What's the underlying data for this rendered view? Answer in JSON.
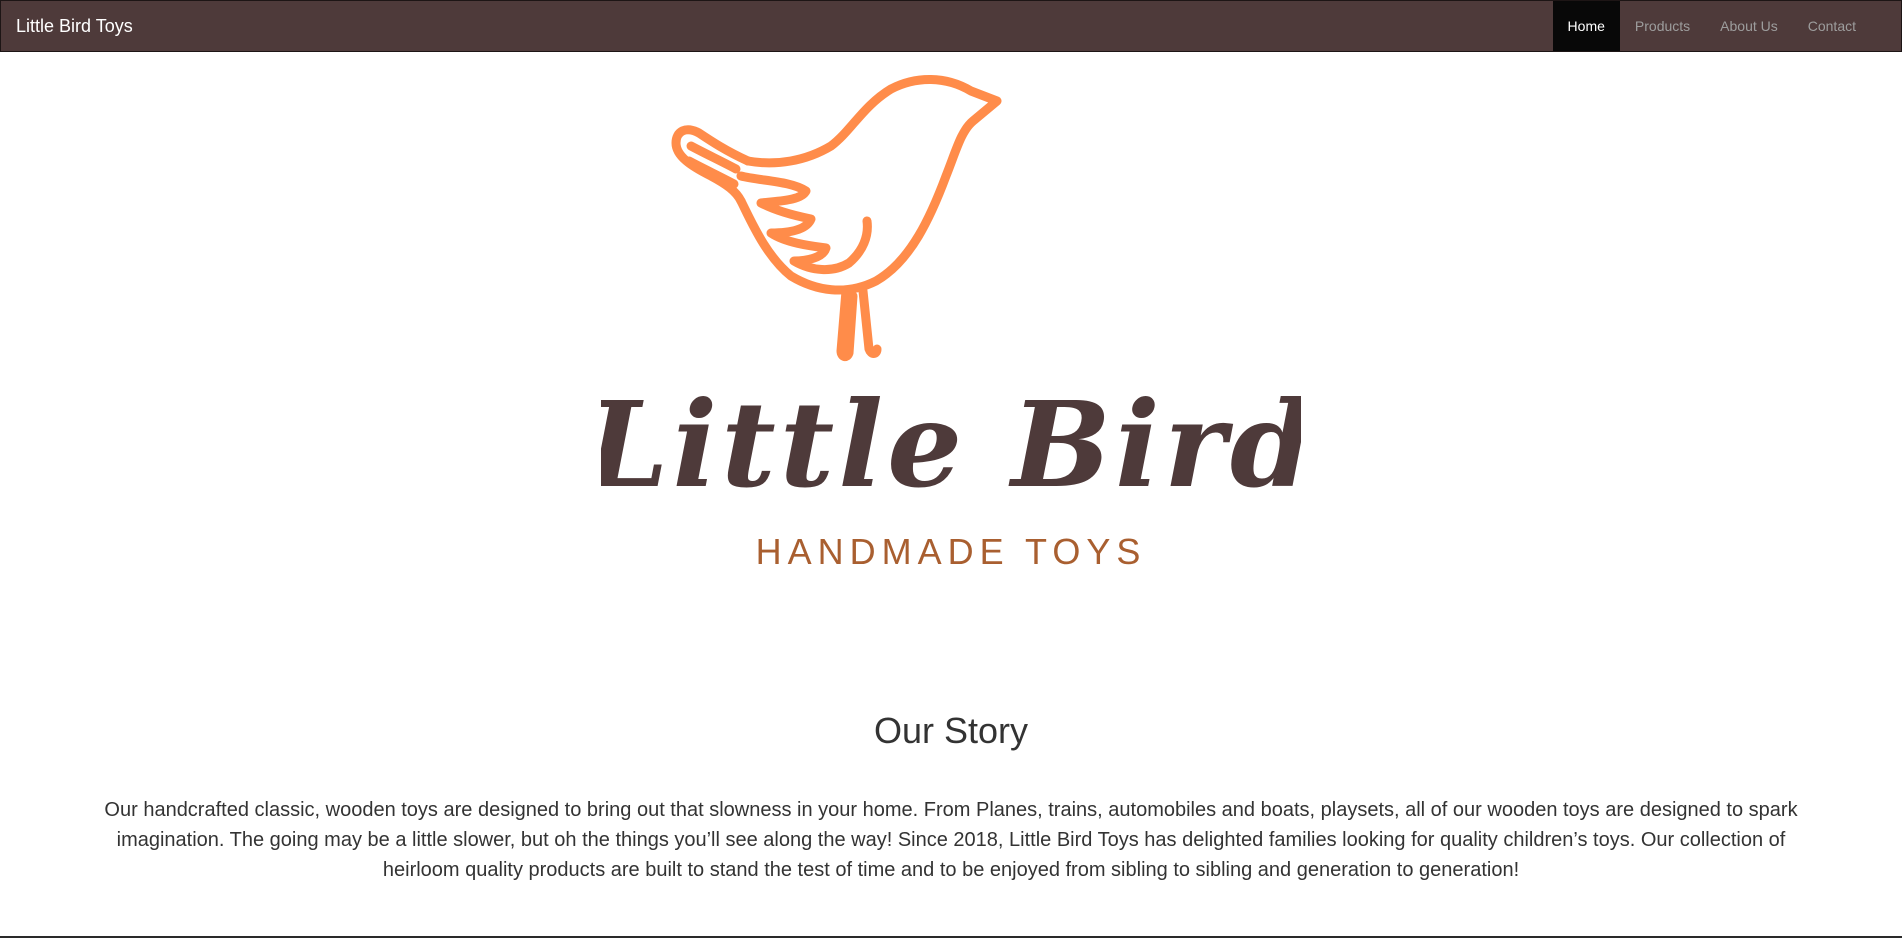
{
  "navbar": {
    "brand": "Little Bird Toys",
    "items": [
      {
        "label": "Home",
        "active": true
      },
      {
        "label": "Products",
        "active": false
      },
      {
        "label": "About Us",
        "active": false
      },
      {
        "label": "Contact",
        "active": false
      }
    ]
  },
  "logo": {
    "icon": "bird-icon",
    "script_text": "Little Bird",
    "tagline": "HANDMADE TOYS",
    "colors": {
      "bird": "#ff8c4a",
      "script": "#4e3a3a",
      "tagline": "#a95f30"
    }
  },
  "story": {
    "title": "Our Story",
    "text": "Our handcrafted classic, wooden toys are designed to bring out that slowness in your home. From Planes, trains, automobiles and boats, playsets, all of our wooden toys are designed to spark imagination. The going may be a little slower, but oh the things you’ll see along the way! Since 2018, Little Bird Toys has delighted families looking for quality children’s toys. Our collection of heirloom quality products are built to stand the test of time and to be enjoyed from sibling to sibling and generation to generation!"
  }
}
